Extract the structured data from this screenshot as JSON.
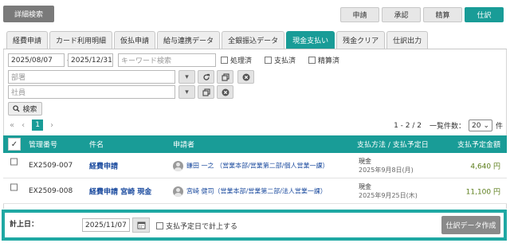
{
  "header": {
    "detail_search": "詳細検索",
    "nav": [
      "申請",
      "承認",
      "精算",
      "仕訳"
    ]
  },
  "tabs": [
    "経費申請",
    "カード利用明細",
    "仮払申請",
    "給与連携データ",
    "全銀振込データ",
    "現金支払い",
    "残金クリア",
    "仕訳出力"
  ],
  "active_tab": "現金支払い",
  "filters": {
    "date_from": "2025/08/07",
    "range_sep": "〜",
    "date_to": "2025/12/31",
    "keyword_placeholder": "キーワード検索",
    "checks": [
      "処理済",
      "支払済",
      "精算済"
    ],
    "dept_placeholder": "部署",
    "employee_placeholder": "社員",
    "search_label": "検索"
  },
  "pager": {
    "first": "«",
    "prev": "‹",
    "current": "1",
    "next": "›",
    "range": "1 - 2 / 2",
    "per_page_label": "一覧件数：",
    "per_page": "20",
    "unit": "件"
  },
  "table": {
    "check_mark": "✓",
    "columns": [
      "管理番号",
      "件名",
      "申請者",
      "支払方法 / 支払予定日",
      "支払予定金額"
    ],
    "rows": [
      {
        "id": "EX2509-007",
        "subject": "経費申請",
        "applicant": "鎌田 一之 （営業本部/営業第二部/個人営業一課）",
        "method": "現金",
        "date": "2025年9月8日(月)",
        "amount": "4,640 円"
      },
      {
        "id": "EX2509-008",
        "subject": "経費申請 宮崎 現金",
        "applicant": "宮崎 健司（営業本部/営業第二部/法人営業一課）",
        "method": "現金",
        "date": "2025年9月25日(木)",
        "amount": "11,100 円"
      }
    ]
  },
  "footer": {
    "label": "計上日：",
    "date": "2025/11/07",
    "checkbox_label": "支払予定日で計上する",
    "action": "仕訳データ作成"
  },
  "colors": {
    "accent": "#199c97",
    "amount": "#5b7d1a",
    "link": "#1a4a9e"
  }
}
